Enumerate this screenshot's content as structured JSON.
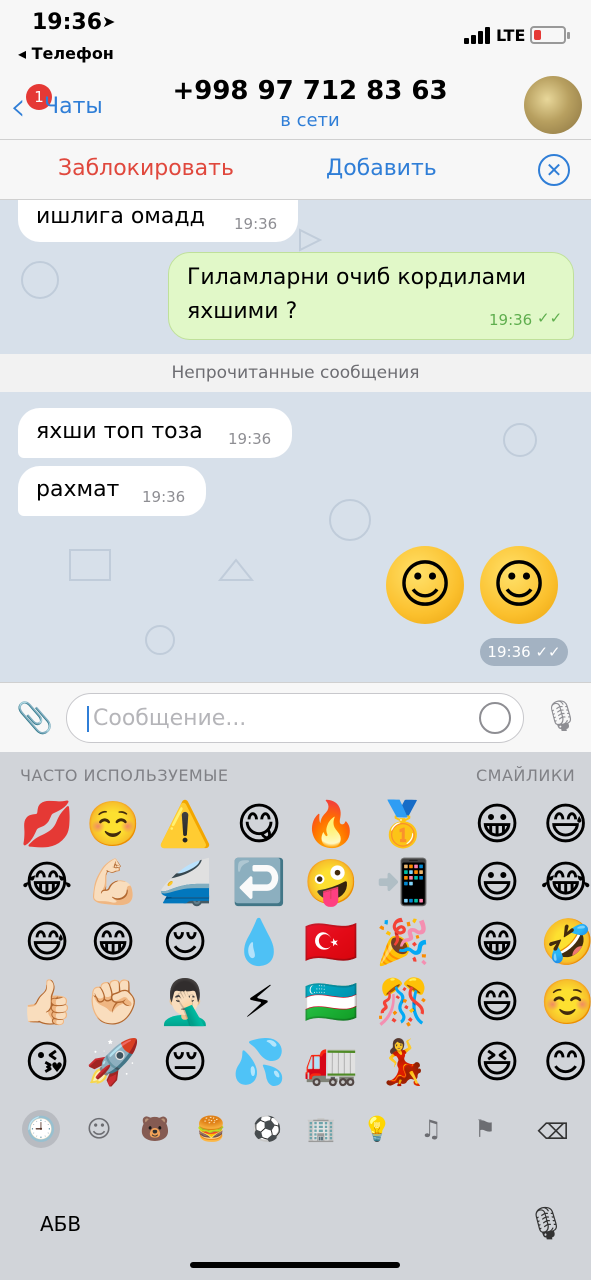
{
  "status_bar": {
    "time": "19:36",
    "location_arrow": "location-arrow-icon",
    "back_to_app": "◂ Телефон",
    "network": "LTE",
    "battery_level": 0.25
  },
  "nav": {
    "back_label": "Чаты",
    "badge_count": "1",
    "title": "+998 97 712 83 63",
    "subtitle": "в сети"
  },
  "actions": {
    "block": "Заблокировать",
    "add": "Добавить",
    "close_icon": "close-circle-icon"
  },
  "messages": [
    {
      "direction": "in",
      "text": "ишлига омадд",
      "time": "19:36"
    },
    {
      "direction": "out",
      "text_line1": "Гиламларни очиб кордилами",
      "text_line2": "яхшими ?",
      "time": "19:36",
      "read": true
    },
    {
      "direction": "in",
      "text": "яхши топ тоза",
      "time": "19:36"
    },
    {
      "direction": "in",
      "text": "рахмат",
      "time": "19:36"
    },
    {
      "direction": "out",
      "emoji": "☺️☺️",
      "time": "19:36",
      "read": true
    }
  ],
  "unread_divider": "Непрочитанные сообщения",
  "input": {
    "placeholder": "Сообщение...",
    "attach_icon": "paperclip-icon",
    "sticker_icon": "sticker-icon",
    "mic_icon": "microphone-icon"
  },
  "keyboard": {
    "frequent_title": "ЧАСТО ИСПОЛЬЗУЕМЫЕ",
    "smileys_title": "СМАЙЛИКИ",
    "frequent_rows": [
      [
        "💋",
        "☺️",
        "⚠️",
        "😋",
        "🔥",
        "🥇"
      ],
      [
        "😂",
        "💪🏻",
        "🚄",
        "↩️",
        "🤪",
        "📲"
      ],
      [
        "😅",
        "😁",
        "😌",
        "💧",
        "🇹🇷",
        "🎉"
      ],
      [
        "👍🏻",
        "✊🏻",
        "🤦🏻‍♂️",
        "⚡",
        "🇺🇿",
        "🎊"
      ],
      [
        "😘",
        "🚀",
        "😔",
        "💦",
        "🚛",
        "💃"
      ]
    ],
    "smiley_rows": [
      [
        "😀",
        "😅"
      ],
      [
        "😃",
        "😂"
      ],
      [
        "😁",
        "🤣"
      ],
      [
        "😄",
        "☺️"
      ],
      [
        "😆",
        "😊"
      ]
    ],
    "categories": [
      {
        "name": "recent",
        "icon": "🕘",
        "selected": true
      },
      {
        "name": "smileys",
        "icon": "☺",
        "selected": false
      },
      {
        "name": "animals",
        "icon": "🐻",
        "selected": false
      },
      {
        "name": "food",
        "icon": "🍔",
        "selected": false
      },
      {
        "name": "activity",
        "icon": "⚽",
        "selected": false
      },
      {
        "name": "travel",
        "icon": "🏢",
        "selected": false
      },
      {
        "name": "objects",
        "icon": "💡",
        "selected": false
      },
      {
        "name": "symbols",
        "icon": "♫",
        "selected": false
      },
      {
        "name": "flags",
        "icon": "⚑",
        "selected": false
      }
    ],
    "abc_label": "АБВ",
    "delete_icon": "backspace-icon",
    "mic_icon": "microphone-icon"
  }
}
